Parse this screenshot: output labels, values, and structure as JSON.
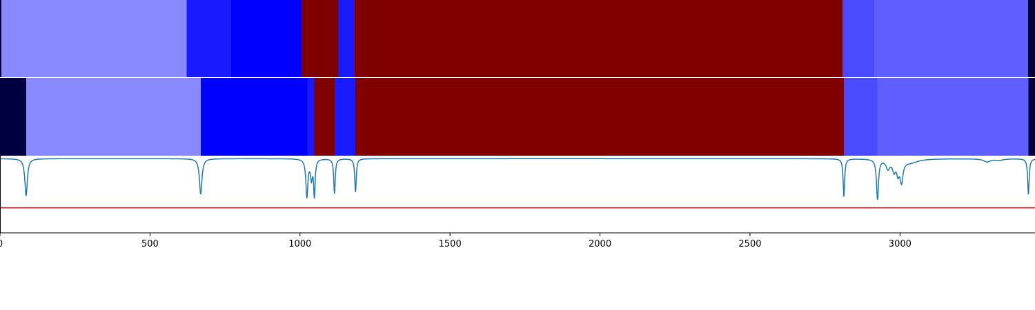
{
  "chart_data": {
    "type": "heatmap",
    "title": "",
    "xlabel": "",
    "xlim": [
      0,
      3450
    ],
    "xticks": [
      0,
      500,
      1000,
      1500,
      2000,
      2500,
      3000
    ],
    "tick_labels": [
      "0",
      "500",
      "1000",
      "1500",
      "2000",
      "2500",
      "3000"
    ],
    "colors": {
      "c_navy": "#000040",
      "c_light": "#8888ff",
      "c_mid": "#1a1aff",
      "c_blue": "#0000ff",
      "c_maroon": "#800000",
      "c_med": "#4a4aff",
      "c_slate": "#5f5fff",
      "line": "#1f77b4",
      "threshold": "#ff0000"
    },
    "segment_rows": [
      {
        "segments": [
          {
            "start": 0,
            "end": 5,
            "color": "c_navy"
          },
          {
            "start": 5,
            "end": 622,
            "color": "c_light"
          },
          {
            "start": 622,
            "end": 770,
            "color": "c_mid"
          },
          {
            "start": 770,
            "end": 1006,
            "color": "c_blue"
          },
          {
            "start": 1006,
            "end": 1128,
            "color": "c_maroon"
          },
          {
            "start": 1128,
            "end": 1182,
            "color": "c_mid"
          },
          {
            "start": 1182,
            "end": 2808,
            "color": "c_maroon"
          },
          {
            "start": 2808,
            "end": 2914,
            "color": "c_med"
          },
          {
            "start": 2914,
            "end": 3427,
            "color": "c_slate"
          },
          {
            "start": 3427,
            "end": 3450,
            "color": "c_navy"
          }
        ]
      },
      {
        "segments": [
          {
            "start": 0,
            "end": 87,
            "color": "c_navy"
          },
          {
            "start": 87,
            "end": 669,
            "color": "c_light"
          },
          {
            "start": 669,
            "end": 1025,
            "color": "c_blue"
          },
          {
            "start": 1025,
            "end": 1048,
            "color": "c_mid"
          },
          {
            "start": 1048,
            "end": 1115,
            "color": "c_maroon"
          },
          {
            "start": 1115,
            "end": 1185,
            "color": "c_mid"
          },
          {
            "start": 1185,
            "end": 2813,
            "color": "c_maroon"
          },
          {
            "start": 2813,
            "end": 2925,
            "color": "c_med"
          },
          {
            "start": 2925,
            "end": 3428,
            "color": "c_slate"
          },
          {
            "start": 3428,
            "end": 3450,
            "color": "c_navy"
          }
        ]
      }
    ],
    "signal": {
      "ylim": [
        0,
        1
      ],
      "threshold": 0.32,
      "baseline": 0.97,
      "dips": [
        {
          "x": 87,
          "depth": 0.49,
          "width": 5
        },
        {
          "x": 669,
          "depth": 0.47,
          "width": 5
        },
        {
          "x": 1023,
          "depth": 0.5,
          "width": 4
        },
        {
          "x": 1038,
          "depth": 0.24,
          "width": 4
        },
        {
          "x": 1048,
          "depth": 0.48,
          "width": 3
        },
        {
          "x": 1115,
          "depth": 0.46,
          "width": 3
        },
        {
          "x": 1185,
          "depth": 0.44,
          "width": 3
        },
        {
          "x": 2813,
          "depth": 0.5,
          "width": 3
        },
        {
          "x": 2925,
          "depth": 0.53,
          "width": 4
        },
        {
          "x": 2960,
          "depth": 0.12,
          "width": 8
        },
        {
          "x": 2980,
          "depth": 0.14,
          "width": 6
        },
        {
          "x": 2993,
          "depth": 0.16,
          "width": 5
        },
        {
          "x": 3005,
          "depth": 0.28,
          "width": 6
        },
        {
          "x": 3035,
          "depth": 0.05,
          "width": 30
        },
        {
          "x": 3290,
          "depth": 0.04,
          "width": 14
        },
        {
          "x": 3330,
          "depth": 0.02,
          "width": 16
        },
        {
          "x": 3428,
          "depth": 0.47,
          "width": 3
        }
      ]
    }
  }
}
